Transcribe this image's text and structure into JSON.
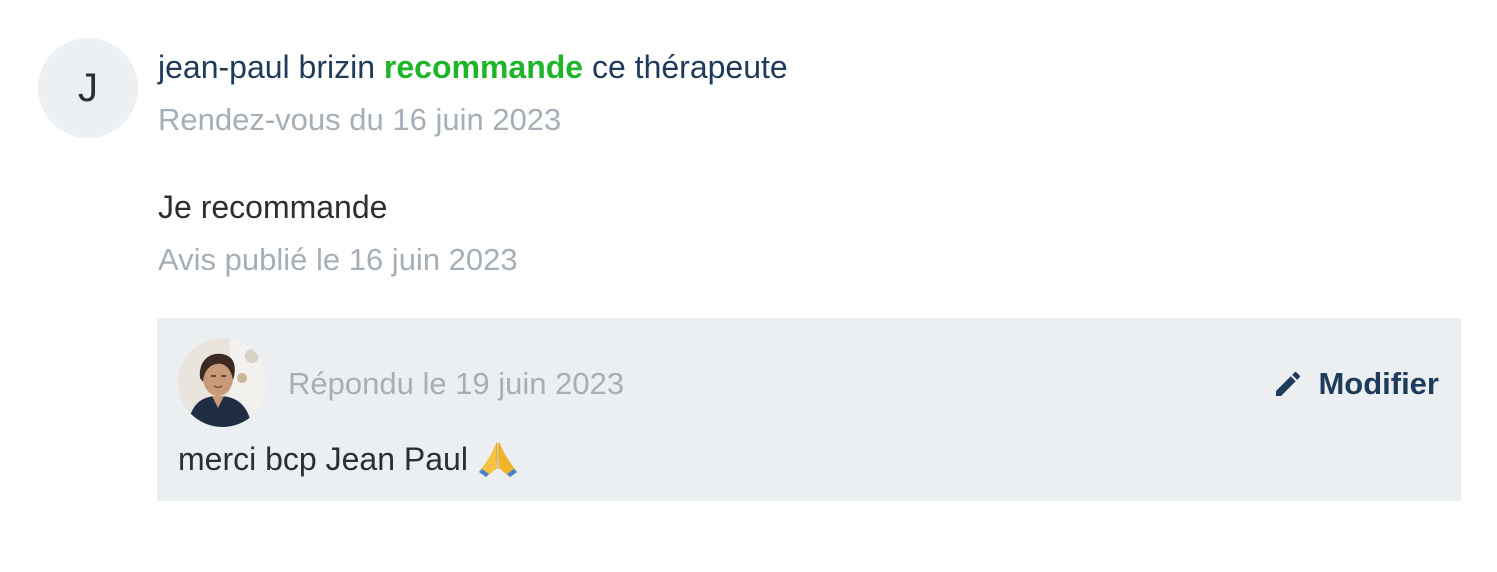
{
  "review": {
    "author_initial": "J",
    "author_name": "jean-paul brizin",
    "recommend_word": "recommande",
    "header_suffix": "ce thérapeute",
    "appointment_date": "Rendez-vous du 16 juin 2023",
    "text": "Je recommande",
    "published_date": "Avis publié le 16 juin 2023"
  },
  "reply": {
    "avatar_icon": "therapist-photo",
    "date": "Répondu le 19 juin 2023",
    "edit_label": "Modifier",
    "edit_icon": "pencil-icon",
    "text": "merci bcp Jean Paul",
    "emoji_icon": "folded-hands-icon"
  },
  "colors": {
    "recommend_green": "#1fb52b",
    "navy": "#1f3b5a",
    "muted_gray": "#a6afb8",
    "reply_background": "#ebeff2",
    "avatar_background": "#edf0f3"
  }
}
